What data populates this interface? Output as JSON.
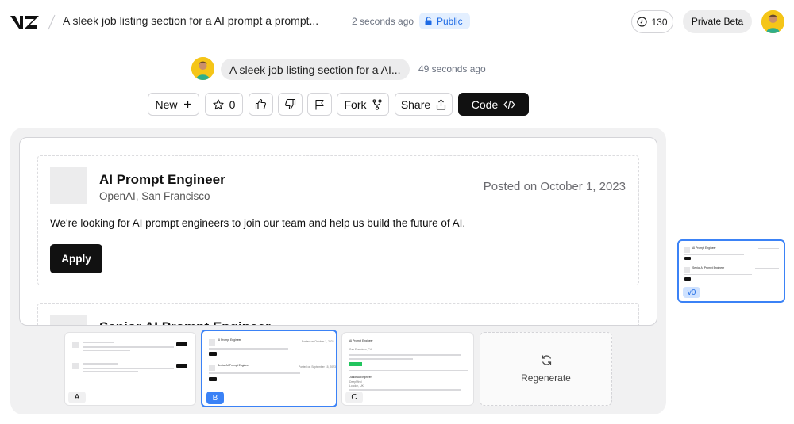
{
  "header": {
    "title": "A sleek job listing section for a AI prompt a prompt...",
    "time_ago": "2 seconds ago",
    "visibility": "Public",
    "credits": "130",
    "beta_label": "Private Beta"
  },
  "prompt": {
    "text": "A sleek job listing section for a AI...",
    "time_ago": "49 seconds ago"
  },
  "toolbar": {
    "new_label": "New",
    "star_count": "0",
    "fork_label": "Fork",
    "share_label": "Share",
    "code_label": "Code"
  },
  "jobs": [
    {
      "title": "AI Prompt Engineer",
      "company": "OpenAI, San Francisco",
      "posted": "Posted on October 1, 2023",
      "description": "We're looking for AI prompt engineers to join our team and help us build the future of AI.",
      "apply_label": "Apply"
    },
    {
      "title": "Senior AI Prompt Engineer"
    }
  ],
  "variants": {
    "a_label": "A",
    "b_label": "B",
    "c_label": "C",
    "regenerate_label": "Regenerate",
    "b_card1_title": "AI Prompt Engineer",
    "b_card1_posted": "Posted on October 1, 2023",
    "b_card2_title": "Senior AI Prompt Engineer",
    "b_card2_posted": "Posted on September 15, 2023",
    "c_card1_title": "AI Prompt Engineer",
    "c_card1_location": "San Francisco, CA",
    "c_card1_button": "Apply Now",
    "c_card2_title": "Junior AI Engineer",
    "c_card2_company": "DeepMind",
    "c_card2_location": "London, UK"
  },
  "history": {
    "version_label": "v0",
    "card1_title": "AI Prompt Engineer",
    "card2_title": "Senior AI Prompt Engineer"
  },
  "colors": {
    "accent_blue": "#1d6ae5",
    "public_bg": "#e3efff",
    "apply_dark": "#111111",
    "apply_green": "#22c55e"
  }
}
